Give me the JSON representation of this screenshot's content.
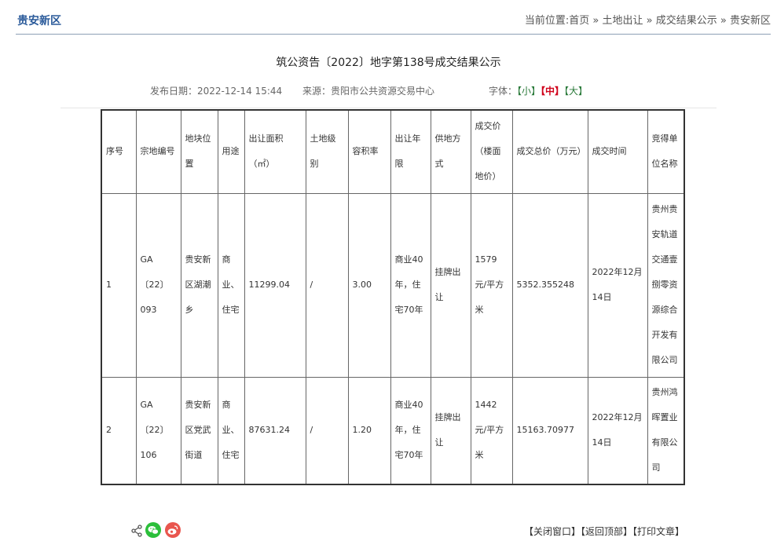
{
  "header": {
    "brand": "贵安新区",
    "breadcrumb": {
      "prefix": "当前位置:",
      "items": [
        "首页",
        "土地出让",
        "成交结果公示",
        "贵安新区"
      ],
      "separator": " » "
    }
  },
  "article": {
    "title": "筑公资告〔2022〕地字第138号成交结果公示",
    "publish_date": "发布日期：2022-12-14 15:44",
    "source": "来源：贵阳市公共资源交易中心",
    "font_label": "字体：",
    "font_small": "【小】",
    "font_mid": "【中】",
    "font_large": "【大】"
  },
  "table": {
    "headers": [
      "序号",
      "宗地编号",
      "地块位置",
      "用途",
      "出让面积（㎡）",
      "土地级别",
      "容积率",
      "出让年限",
      "供地方式",
      "成交价（楼面地价）",
      "成交总价（万元）",
      "成交时间",
      "竞得单位名称"
    ],
    "rows": [
      [
        "1",
        "GA〔22〕093",
        "贵安新区湖潮乡",
        "商业、住宅",
        "11299.04",
        "/",
        "3.00",
        "商业40年，住宅70年",
        "挂牌出让",
        "1579元/平方米",
        "5352.355248",
        "2022年12月14日",
        "贵州贵安轨道交通壹捌零资源综合开发有限公司"
      ],
      [
        "2",
        "GA〔22〕106",
        "贵安新区党武街道",
        "商业、住宅",
        "87631.24",
        "/",
        "1.20",
        "商业40年，住宅70年",
        "挂牌出让",
        "1442元/平方米",
        "15163.70977",
        "2022年12月14日",
        "贵州鸿晖置业有限公司"
      ]
    ]
  },
  "footer": {
    "share_icons": [
      "share-icon",
      "wechat-icon",
      "weibo-icon"
    ],
    "close": "【关闭窗口】",
    "top": "【返回顶部】",
    "print": "【打印文章】"
  }
}
